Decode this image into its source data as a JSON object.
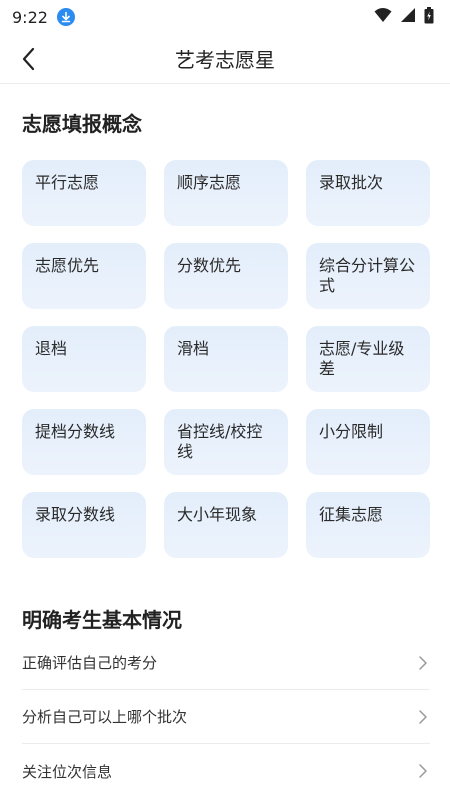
{
  "status_bar": {
    "time": "9:22",
    "icons": [
      "download-badge-icon",
      "wifi-icon",
      "signal-icon",
      "battery-icon"
    ]
  },
  "header": {
    "title": "艺考志愿星",
    "back_icon": "chevron-left-icon"
  },
  "concepts": {
    "title": "志愿填报概念",
    "items": [
      "平行志愿",
      "顺序志愿",
      "录取批次",
      "志愿优先",
      "分数优先",
      "综合分计算公式",
      "退档",
      "滑档",
      "志愿/专业级差",
      "提档分数线",
      "省控线/校控线",
      "小分限制",
      "录取分数线",
      "大小年现象",
      "征集志愿"
    ]
  },
  "basics": {
    "title": "明确考生基本情况",
    "items": [
      "正确评估自己的考分",
      "分析自己可以上哪个批次",
      "关注位次信息"
    ]
  },
  "colors": {
    "card_bg": "#e6f0fb",
    "accent": "#2a8cf0"
  }
}
